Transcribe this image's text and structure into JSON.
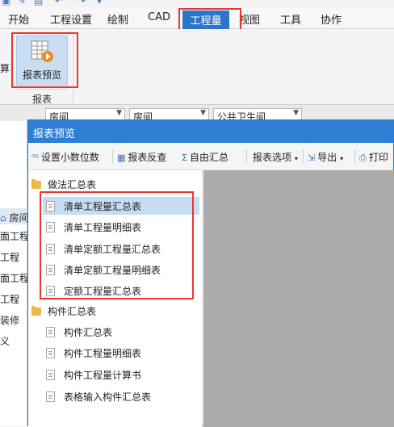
{
  "ribbon": {
    "tabs": [
      "开始",
      "工程设置",
      "绘制",
      "CAD",
      "工程量",
      "视图",
      "工具",
      "协作"
    ],
    "active_tab": "工程量",
    "left_cut_label": "算",
    "report_preview_button": "报表预览",
    "group_label": "报表"
  },
  "dropdowns": [
    "房间",
    "房间",
    "公共卫生间"
  ],
  "background_tree": [
    "房间",
    "面工程",
    "工程",
    "面工程",
    "工程",
    "装修",
    "义"
  ],
  "dialog": {
    "title": "报表预览",
    "toolbar": {
      "set_decimals": "设置小数位数",
      "report_check": "报表反查",
      "free_summary": "自由汇总",
      "report_options": "报表选项",
      "export": "导出",
      "print": "打印"
    },
    "tree": {
      "group1": {
        "label": "做法汇总表",
        "items": [
          "清单工程量汇总表",
          "清单工程量明细表",
          "清单定额工程量汇总表",
          "清单定额工程量明细表",
          "定额工程量汇总表"
        ]
      },
      "group2": {
        "label": "构件汇总表",
        "items": [
          "构件汇总表",
          "构件工程量明细表",
          "构件工程量计算书",
          "表格输入构件汇总表"
        ]
      }
    }
  },
  "colors": {
    "accent": "#2e74c9",
    "highlight": "#ee3333",
    "selection": "#c6dcf2",
    "preview_bg": "#ababab"
  }
}
